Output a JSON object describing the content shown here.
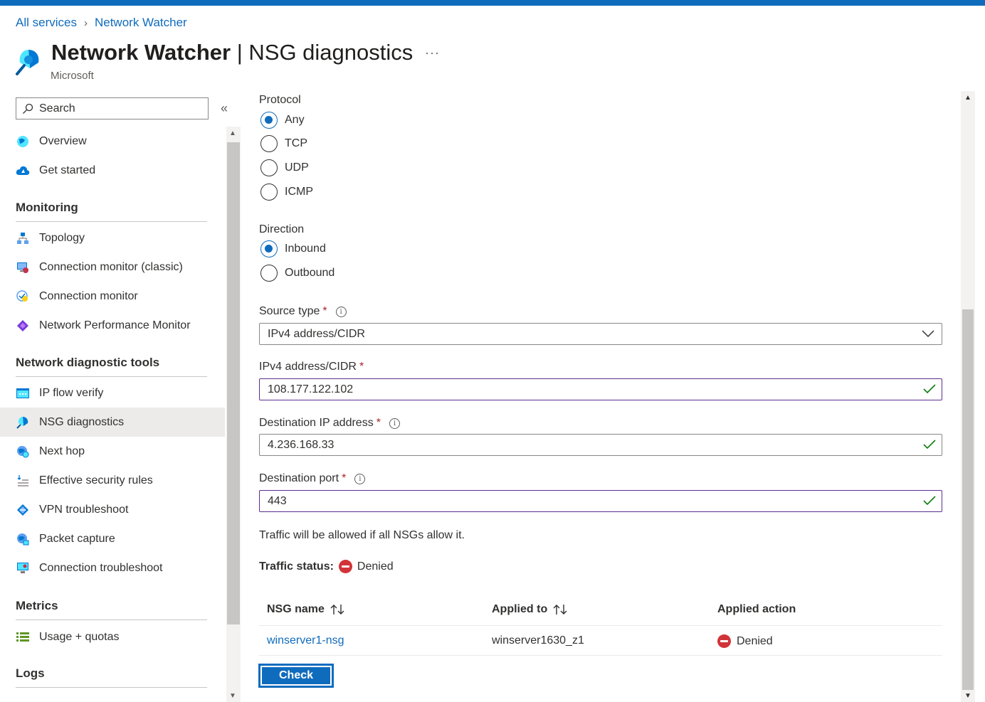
{
  "breadcrumb": {
    "items": [
      "All services",
      "Network Watcher"
    ]
  },
  "header": {
    "service": "Network Watcher",
    "separator": "|",
    "page": "NSG diagnostics",
    "more": "···",
    "publisher": "Microsoft"
  },
  "sidebar": {
    "search_placeholder": "Search",
    "collapse": "«",
    "top_items": [
      {
        "label": "Overview",
        "icon": "globe-icon"
      },
      {
        "label": "Get started",
        "icon": "cloud-icon"
      }
    ],
    "sections": [
      {
        "title": "Monitoring",
        "items": [
          {
            "label": "Topology",
            "icon": "topology-icon"
          },
          {
            "label": "Connection monitor (classic)",
            "icon": "monitor-classic-icon"
          },
          {
            "label": "Connection monitor",
            "icon": "connection-monitor-icon"
          },
          {
            "label": "Network Performance Monitor",
            "icon": "performance-icon"
          }
        ]
      },
      {
        "title": "Network diagnostic tools",
        "items": [
          {
            "label": "IP flow verify",
            "icon": "ip-flow-icon"
          },
          {
            "label": "NSG diagnostics",
            "icon": "nsg-icon",
            "active": true
          },
          {
            "label": "Next hop",
            "icon": "next-hop-icon"
          },
          {
            "label": "Effective security rules",
            "icon": "security-rules-icon"
          },
          {
            "label": "VPN troubleshoot",
            "icon": "vpn-icon"
          },
          {
            "label": "Packet capture",
            "icon": "packet-capture-icon"
          },
          {
            "label": "Connection troubleshoot",
            "icon": "connection-troubleshoot-icon"
          }
        ]
      },
      {
        "title": "Metrics",
        "items": [
          {
            "label": "Usage + quotas",
            "icon": "usage-icon"
          }
        ]
      },
      {
        "title": "Logs",
        "items": []
      }
    ]
  },
  "form": {
    "protocol": {
      "label": "Protocol",
      "options": [
        "Any",
        "TCP",
        "UDP",
        "ICMP"
      ],
      "selected": "Any"
    },
    "direction": {
      "label": "Direction",
      "options": [
        "Inbound",
        "Outbound"
      ],
      "selected": "Inbound"
    },
    "source_type": {
      "label": "Source type",
      "required": "*",
      "value": "IPv4 address/CIDR"
    },
    "ipv4": {
      "label": "IPv4 address/CIDR",
      "required": "*",
      "value": "108.177.122.102"
    },
    "dest_ip": {
      "label": "Destination IP address",
      "required": "*",
      "value": "4.236.168.33"
    },
    "dest_port": {
      "label": "Destination port",
      "required": "*",
      "value": "443"
    },
    "note": "Traffic will be allowed if all NSGs allow it.",
    "traffic_status": {
      "label": "Traffic status:",
      "value": "Denied"
    }
  },
  "table": {
    "columns": [
      "NSG name",
      "Applied to",
      "Applied action"
    ],
    "rows": [
      {
        "nsg_name": "winserver1-nsg",
        "applied_to": "winserver1630_z1",
        "action": "Denied"
      }
    ]
  },
  "actions": {
    "check_label": "Check"
  },
  "colors": {
    "accent": "#0f6cbd",
    "denied": "#d13438",
    "valid_border": "#5c2e91",
    "valid_check": "#107c10"
  }
}
